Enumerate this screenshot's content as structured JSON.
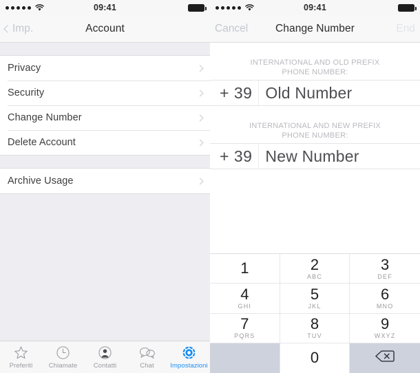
{
  "left_screen": {
    "statusbar": {
      "signal_dots": 5,
      "wifi_icon": "wifi-icon",
      "time": "09:41",
      "battery_icon": "battery-full-icon"
    },
    "navbar": {
      "back_icon": "chevron-left-icon",
      "back_label": "Imp.",
      "title": "Account"
    },
    "group_one": [
      {
        "label": "Privacy",
        "accessory": "chevron-right-icon"
      },
      {
        "label": "Security",
        "accessory": "chevron-right-icon"
      },
      {
        "label": "Change Number",
        "accessory": "chevron-right-icon"
      },
      {
        "label": "Delete Account",
        "accessory": "chevron-right-icon"
      }
    ],
    "group_two": [
      {
        "label": "Archive Usage",
        "accessory": "chevron-right-icon"
      }
    ],
    "tabbar": [
      {
        "label": "Preferiti",
        "icon": "star-icon",
        "active": false
      },
      {
        "label": "Chiamate",
        "icon": "clock-icon",
        "active": false
      },
      {
        "label": "Contatti",
        "icon": "person-icon",
        "active": false
      },
      {
        "label": "Chat",
        "icon": "chat-bubbles-icon",
        "active": false
      },
      {
        "label": "Impostazioni",
        "icon": "gear-icon",
        "active": true
      }
    ]
  },
  "right_screen": {
    "statusbar": {
      "signal_dots": 5,
      "wifi_icon": "wifi-icon",
      "time": "09:41",
      "battery_icon": "battery-full-icon"
    },
    "navbar": {
      "cancel_label": "Cancel",
      "title": "Change Number",
      "end_label": "End"
    },
    "old_field": {
      "label_line1": "INTERNATIONAL AND OLD PREFIX",
      "label_line2": "PHONE NUMBER:",
      "prefix": "+ 39",
      "value": "Old Number"
    },
    "new_field": {
      "label_line1": "INTERNATIONAL AND NEW PREFIX",
      "label_line2": "PHONE NUMBER:",
      "prefix": "+ 39",
      "value": "New Number"
    },
    "keypad": [
      {
        "digit": "1",
        "letters": ""
      },
      {
        "digit": "2",
        "letters": "ABC"
      },
      {
        "digit": "3",
        "letters": "DEF"
      },
      {
        "digit": "4",
        "letters": "GHI"
      },
      {
        "digit": "5",
        "letters": "JKL"
      },
      {
        "digit": "6",
        "letters": "MNO"
      },
      {
        "digit": "7",
        "letters": "PQRS"
      },
      {
        "digit": "8",
        "letters": "TUV"
      },
      {
        "digit": "9",
        "letters": "WXYZ"
      },
      {
        "digit": "",
        "letters": ""
      },
      {
        "digit": "0",
        "letters": ""
      },
      {
        "digit": "",
        "letters": "",
        "icon": "backspace-icon"
      }
    ]
  },
  "colors": {
    "accent_blue": "#1b8cf0",
    "page_bg": "#eeeef2",
    "bar_bg": "#f7f7f8",
    "keypad_gray": "#ced2dc"
  }
}
